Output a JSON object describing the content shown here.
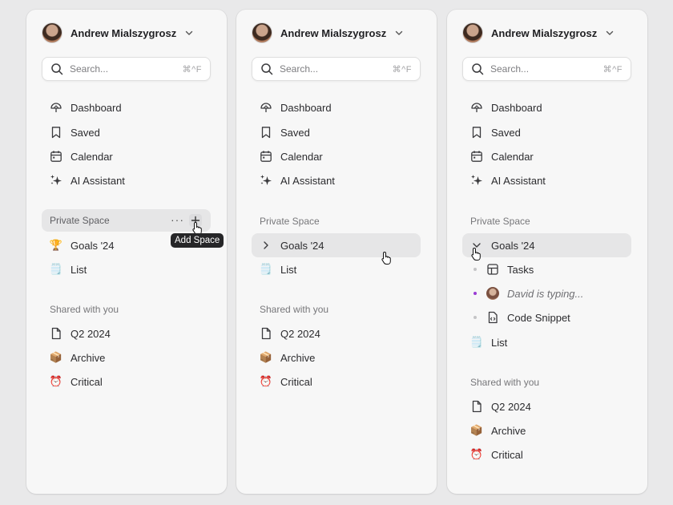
{
  "user": {
    "name": "Andrew Mialszygrosz"
  },
  "search": {
    "placeholder": "Search...",
    "shortcut": "⌘^F"
  },
  "nav": [
    {
      "label": "Dashboard",
      "icon": "dashboard-gauge-icon"
    },
    {
      "label": "Saved",
      "icon": "bookmark-icon"
    },
    {
      "label": "Calendar",
      "icon": "calendar-icon"
    },
    {
      "label": "AI Assistant",
      "icon": "sparkles-icon"
    }
  ],
  "private_space": {
    "title": "Private Space",
    "more_label": "···",
    "add_tooltip": "Add Space",
    "items": [
      {
        "label": "Goals '24",
        "emoji": "🏆"
      },
      {
        "label": "List",
        "emoji": "🗒️"
      }
    ],
    "goals_children": [
      {
        "label": "Tasks",
        "icon": "table-icon"
      },
      {
        "label": "David is typing...",
        "icon": "avatar"
      },
      {
        "label": "Code Snippet",
        "icon": "code-file-icon"
      }
    ]
  },
  "shared": {
    "title": "Shared with you",
    "items": [
      {
        "label": "Q2 2024",
        "icon": "document-icon"
      },
      {
        "label": "Archive",
        "emoji": "📦"
      },
      {
        "label": "Critical",
        "emoji": "⏰"
      }
    ]
  },
  "colors": {
    "panel": "#f7f7f7",
    "background": "#e9e9ea",
    "highlight": "#e6e6e7",
    "typing_dot": "#9a3bd4"
  }
}
